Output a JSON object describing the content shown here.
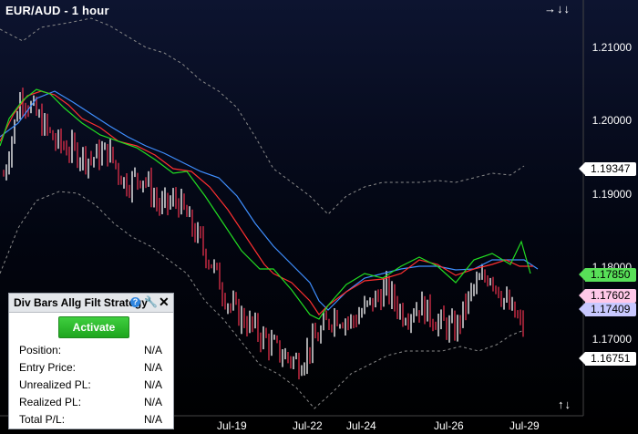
{
  "window": {
    "title": "EUR/AUD - 1 hour",
    "nav_right_top": "→↓↓",
    "nav_right_bottom": "↑↓"
  },
  "axis": {
    "y_labels": [
      "1.21000",
      "1.20000",
      "1.19000",
      "1.18000",
      "1.17000"
    ],
    "x_labels": [
      "Jul-19",
      "Jul-22",
      "Jul-24",
      "Jul-26",
      "Jul-29"
    ]
  },
  "price_labels": [
    {
      "value": "1.19347",
      "color": "#ffffff"
    },
    {
      "value": "1.17850",
      "color": "#58e058"
    },
    {
      "value": "1.17602",
      "color": "#ffc8e8"
    },
    {
      "value": "1.17409",
      "color": "#c8c8ff"
    },
    {
      "value": "1.16751",
      "color": "#ffffff"
    }
  ],
  "panel": {
    "title": "Div Bars Allg Filt Strategy",
    "help_glyph": "?",
    "wrench_glyph": "🔧",
    "close_glyph": "✕",
    "activate_label": "Activate",
    "rows": [
      {
        "label": "Position:",
        "value": "N/A"
      },
      {
        "label": "Entry Price:",
        "value": "N/A"
      },
      {
        "label": "Unrealized PL:",
        "value": "N/A"
      },
      {
        "label": "Realized PL:",
        "value": "N/A"
      },
      {
        "label": "Total P/L:",
        "value": "N/A"
      }
    ]
  },
  "colors": {
    "up_bar": "#ffffff",
    "down_bar": "#e0304a",
    "ma_fast": "#22dd22",
    "ma_mid": "#ff3030",
    "ma_slow": "#3f8fff",
    "band": "#8a8a8a"
  },
  "chart_data": {
    "type": "line",
    "symbol": "EUR/AUD",
    "timeframe": "1 hour",
    "ylim": [
      1.1645,
      1.2155
    ],
    "y_ticks": [
      1.21,
      1.2,
      1.19,
      1.18,
      1.17
    ],
    "x_tick_labels": [
      "Jul-19",
      "Jul-22",
      "Jul-24",
      "Jul-26",
      "Jul-29"
    ],
    "last_values": {
      "upper_band": 1.19347,
      "ma_fast": 1.1785,
      "close": 1.17602,
      "ma_slow": 1.17409,
      "lower_band": 1.16751
    },
    "close_path": [
      1.194,
      1.204,
      1.201,
      1.198,
      1.197,
      1.196,
      1.197,
      1.193,
      1.194,
      1.19,
      1.191,
      1.187,
      1.183,
      1.178,
      1.176,
      1.174,
      1.172,
      1.171,
      1.174,
      1.177,
      1.176,
      1.178,
      1.18,
      1.177,
      1.178,
      1.176,
      1.175,
      1.18,
      1.182,
      1.178,
      1.175
    ]
  }
}
